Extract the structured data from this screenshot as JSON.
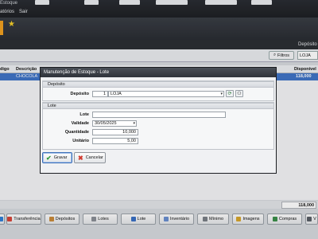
{
  "app": {
    "title_fragment": "Estoque",
    "menu": [
      "atórios",
      "Sair"
    ]
  },
  "filters": {
    "filter_button": "Filtros",
    "deposito_header": "Depósito",
    "deposito_value": "LOJA"
  },
  "grid": {
    "headers": [
      "digo",
      "Descrição",
      "Disponível"
    ],
    "selected_row": {
      "code": "",
      "description": "CHOCOLA",
      "disponivel": "118,000"
    },
    "total": "118,000"
  },
  "bottom_buttons": [
    {
      "label": "",
      "icon": "arrow-icon",
      "color": "#2f7fd6"
    },
    {
      "label": "Transferência",
      "icon": "transfer-icon",
      "color": "#d6463a"
    },
    {
      "label": "Depósitos",
      "icon": "warehouse-icon",
      "color": "#c98a3a"
    },
    {
      "label": "Lotes",
      "icon": "lots-icon",
      "color": "#8a8f96"
    },
    {
      "label": "Lote",
      "icon": "lot-icon",
      "color": "#3a70c4"
    },
    {
      "label": "Inventário",
      "icon": "inventory-icon",
      "color": "#6a8fd0"
    },
    {
      "label": "Mínimo",
      "icon": "minimum-icon",
      "color": "#7a7f86"
    },
    {
      "label": "Imagens",
      "icon": "images-icon",
      "color": "#d6a52c"
    },
    {
      "label": "Compras",
      "icon": "cart-icon",
      "color": "#3b8f4a"
    },
    {
      "label": "V",
      "icon": "v-icon",
      "color": "#5a5f66"
    }
  ],
  "modal": {
    "title": "Manutenção de Estoque - Lote",
    "section_deposito": "Depósito",
    "deposito_label": "Depósito",
    "deposito_code": "1",
    "deposito_name": "LOJA",
    "section_lote": "Lote",
    "lote_label": "Lote",
    "lote_value": "",
    "validade_label": "Validade",
    "validade_value": "30/05/2025",
    "quantidade_label": "Quantidade",
    "quantidade_value": "10,000",
    "unitario_label": "Unitário",
    "unitario_value": "5,00",
    "save_label": "Gravar",
    "cancel_label": "Cancelar"
  }
}
